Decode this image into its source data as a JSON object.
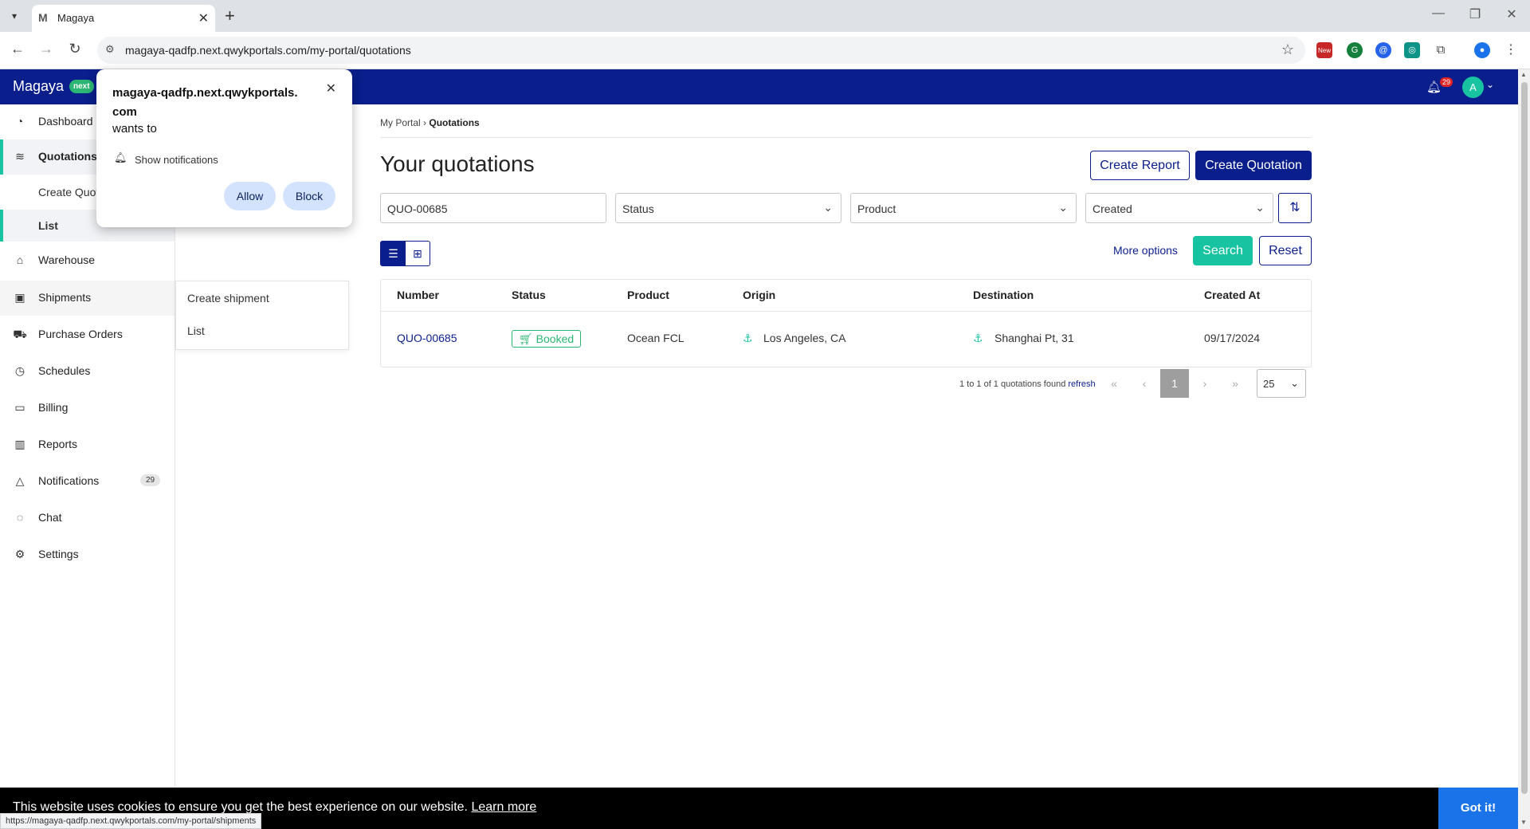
{
  "browser": {
    "tab_title": "Magaya",
    "tab_favicon": "M",
    "url": "magaya-qadfp.next.qwykportals.com/my-portal/quotations",
    "status_url": "https://magaya-qadfp.next.qwykportals.com/my-portal/shipments",
    "extension_badge": "New"
  },
  "header": {
    "brand": "Magaya",
    "brand_badge": "next",
    "notification_count": "29",
    "avatar_initial": "A",
    "color_primary": "#0a1e8c",
    "color_accent": "#17c3a0"
  },
  "permission_popup": {
    "site": "magaya-qadfp.next.qwykportals.com",
    "wants_to": "wants to",
    "permission": "Show notifications",
    "allow_label": "Allow",
    "block_label": "Block"
  },
  "sidebar": {
    "items": [
      {
        "label": "Dashboard",
        "icon": "gauge-icon"
      },
      {
        "label": "Quotations",
        "icon": "quote-icon"
      },
      {
        "label": "Create Quotation",
        "icon": ""
      },
      {
        "label": "List",
        "icon": ""
      },
      {
        "label": "Warehouse",
        "icon": "warehouse-icon"
      },
      {
        "label": "Shipments",
        "icon": "box-icon"
      },
      {
        "label": "Purchase Orders",
        "icon": "cart-icon"
      },
      {
        "label": "Schedules",
        "icon": "clock-icon"
      },
      {
        "label": "Billing",
        "icon": "card-icon"
      },
      {
        "label": "Reports",
        "icon": "chart-icon"
      },
      {
        "label": "Notifications",
        "icon": "bell-icon",
        "badge": "29"
      },
      {
        "label": "Chat",
        "icon": "chat-icon"
      },
      {
        "label": "Settings",
        "icon": "gear-icon"
      }
    ],
    "flyout": [
      "Create shipment",
      "List"
    ]
  },
  "main": {
    "breadcrumb_root": "My Portal",
    "breadcrumb_sep": "›",
    "breadcrumb_current": "Quotations",
    "title": "Your quotations",
    "create_report_label": "Create Report",
    "create_quotation_label": "Create Quotation",
    "filters": {
      "search_value": "QUO-00685",
      "status_placeholder": "Status",
      "product_placeholder": "Product",
      "sort_value": "Created"
    },
    "more_options_label": "More options",
    "search_label": "Search",
    "reset_label": "Reset"
  },
  "table": {
    "columns": [
      "Number",
      "Status",
      "Product",
      "Origin",
      "Destination",
      "Created At"
    ],
    "rows": [
      {
        "number": "QUO-00685",
        "status": "Booked",
        "product": "Ocean FCL",
        "origin": "Los Angeles, CA",
        "destination": "Shanghai Pt, 31",
        "created_at": "09/17/2024"
      }
    ]
  },
  "pagination": {
    "summary": "1 to 1 of 1 quotations found",
    "refresh_label": "refresh",
    "current_page": "1",
    "page_size": "25"
  },
  "cookie": {
    "message": "This website uses cookies to ensure you get the best experience on our website.",
    "learn_more": "Learn more",
    "accept_label": "Got it!"
  }
}
